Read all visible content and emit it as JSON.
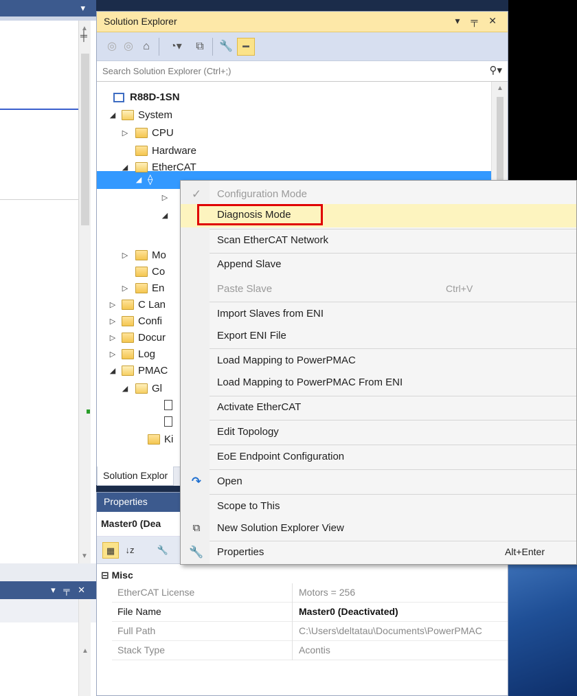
{
  "solution_explorer": {
    "title": "Solution Explorer",
    "title_controls": "▾ ╤ ✕",
    "search_placeholder": "Search Solution Explorer (Ctrl+;)",
    "tree": {
      "project": "R88D-1SN",
      "system": "System",
      "cpu": "CPU",
      "hardware": "Hardware",
      "ethercat": "EtherCAT",
      "motion_partial": "Mo",
      "co_partial": "Co",
      "en_partial": "En",
      "c_lang_partial": "C Lan",
      "config_partial": "Confi",
      "docs_partial": "Docur",
      "log": "Log",
      "pmac_partial": "PMAC",
      "gl_partial": "Gl",
      "ki_partial": "Ki"
    },
    "bottom_tab": "Solution Explor"
  },
  "properties": {
    "title": "Properties",
    "object": "Master0 (Dea",
    "category": "Misc",
    "rows": [
      {
        "key": "EtherCAT License",
        "value": "Motors = 256"
      },
      {
        "key": "File Name",
        "value": "Master0 (Deactivated)"
      },
      {
        "key": "Full Path",
        "value": "C:\\Users\\deltatau\\Documents\\PowerPMAC"
      },
      {
        "key": "Stack Type",
        "value": "Acontis"
      }
    ]
  },
  "context_menu": {
    "items": [
      {
        "label": "Configuration Mode",
        "checked": true,
        "disabled": true
      },
      {
        "label": "Diagnosis Mode",
        "highlighted": true
      },
      {
        "label": "Scan EtherCAT Network"
      },
      {
        "label": "Append Slave"
      },
      {
        "label": "Paste Slave",
        "shortcut": "Ctrl+V",
        "disabled": true
      },
      {
        "label": "Import Slaves from ENI"
      },
      {
        "label": "Export ENI File"
      },
      {
        "label": "Load Mapping to PowerPMAC"
      },
      {
        "label": "Load Mapping to PowerPMAC From ENI"
      },
      {
        "label": "Activate EtherCAT"
      },
      {
        "label": "Edit Topology"
      },
      {
        "label": "EoE Endpoint Configuration"
      },
      {
        "label": "Open",
        "icon": "open-arrow-icon"
      },
      {
        "label": "Scope to This"
      },
      {
        "label": "New Solution Explorer View",
        "icon": "new-view-icon"
      },
      {
        "label": "Properties",
        "shortcut": "Alt+Enter",
        "icon": "wrench-icon"
      }
    ]
  },
  "colors": {
    "title_bar_active": "#fde8a8",
    "panel_header": "#3c5a8e",
    "selection": "#3399ff",
    "highlight_box": "#e00000",
    "menu_hover": "#fdf4bf"
  }
}
